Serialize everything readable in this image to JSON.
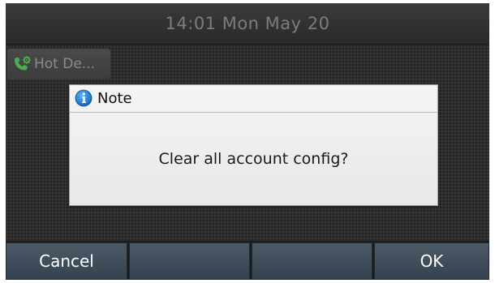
{
  "status_bar": {
    "time": "14:01 Mon May 20"
  },
  "line_key": {
    "label": "Hot De...",
    "icon": "phone-gear-icon",
    "icon_color": "#4caf50"
  },
  "dialog": {
    "title": "Note",
    "icon": "info-icon",
    "message": "Clear all account config?"
  },
  "softkeys": [
    {
      "label": "Cancel"
    },
    {
      "label": ""
    },
    {
      "label": ""
    },
    {
      "label": "OK"
    }
  ],
  "colors": {
    "softkey_top": "#4b5a66",
    "softkey_bottom": "#354350",
    "info_blue": "#1a7fd4"
  }
}
